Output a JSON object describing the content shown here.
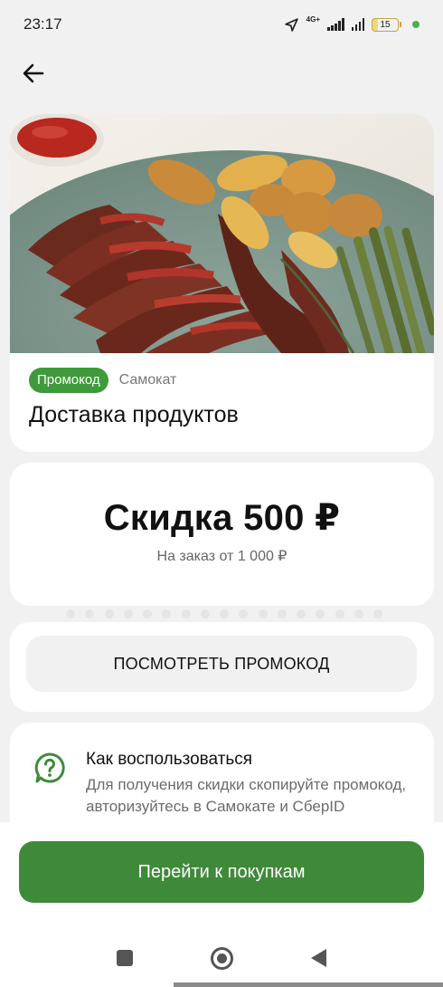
{
  "status_bar": {
    "time": "23:17",
    "network": "4G+",
    "battery": "15",
    "icons": [
      "location-arrow-icon",
      "signal-icon",
      "battery-icon"
    ]
  },
  "header": {
    "back_icon": "arrow-left-icon"
  },
  "offer": {
    "badge": "Промокод",
    "brand": "Самокат",
    "title": "Доставка продуктов"
  },
  "discount": {
    "title": "Скидка 500 ₽",
    "subtitle": "На заказ от 1 000 ₽",
    "view_code_button": "ПОСМОТРЕТЬ ПРОМОКОД"
  },
  "how_to": {
    "icon": "question-bubble-icon",
    "title": "Как воспользоваться",
    "text": "Для получения скидки скопируйте промокод, авторизуйтесь в Самокате и СберID"
  },
  "cta": {
    "label": "Перейти к покупкам"
  },
  "colors": {
    "brand_green": "#3f8a39",
    "badge_green": "#3f9a3b",
    "background": "#f1f1f1"
  }
}
